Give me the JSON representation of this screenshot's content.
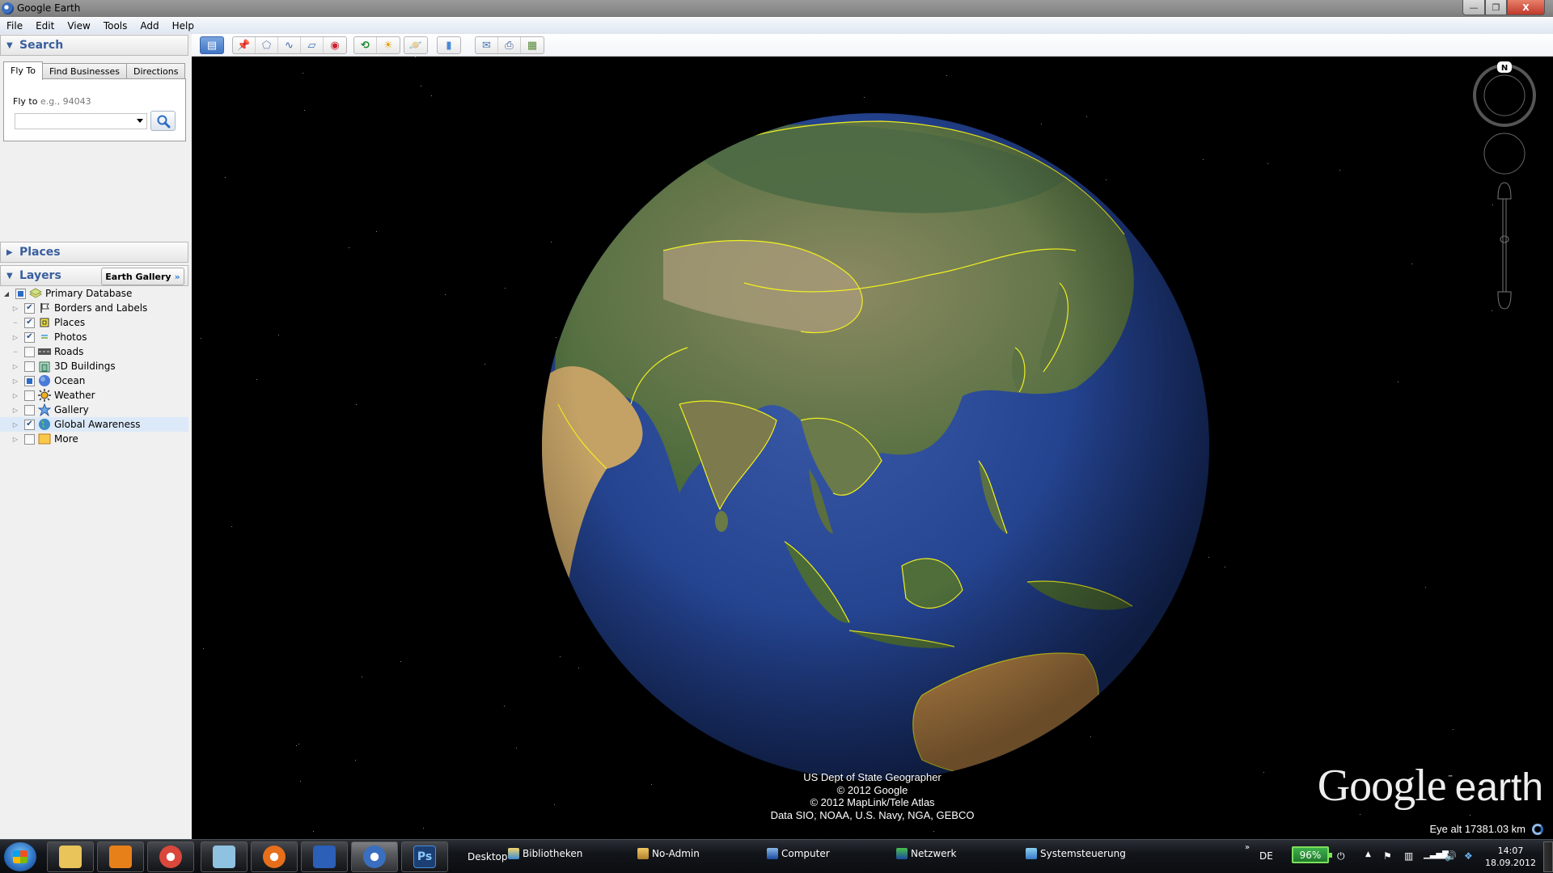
{
  "window": {
    "title": "Google Earth",
    "controls": {
      "minimize": "—",
      "maximize": "❐",
      "close": "X"
    }
  },
  "menu": [
    "File",
    "Edit",
    "View",
    "Tools",
    "Add",
    "Help"
  ],
  "search_panel": {
    "header": "Search",
    "tabs": [
      {
        "label": "Fly To",
        "active": true
      },
      {
        "label": "Find Businesses",
        "active": false
      },
      {
        "label": "Directions",
        "active": false
      }
    ],
    "flyto_label": "Fly to",
    "flyto_hint": "e.g., 94043",
    "flyto_value": ""
  },
  "places_panel": {
    "header": "Places"
  },
  "layers_panel": {
    "header": "Layers",
    "earth_gallery_button": "Earth Gallery",
    "earth_gallery_arrow": "»",
    "root": {
      "label": "Primary Database",
      "state": "partial"
    },
    "items": [
      {
        "label": "Borders and Labels",
        "checked": true,
        "icon": "flag-icon",
        "expandable": true
      },
      {
        "label": "Places",
        "checked": true,
        "icon": "places-icon",
        "expandable": false
      },
      {
        "label": "Photos",
        "checked": true,
        "icon": "photos-icon",
        "expandable": true
      },
      {
        "label": "Roads",
        "checked": false,
        "icon": "roads-icon",
        "expandable": false
      },
      {
        "label": "3D Buildings",
        "checked": false,
        "icon": "buildings-icon",
        "expandable": true
      },
      {
        "label": "Ocean",
        "checked": "partial",
        "icon": "ocean-icon",
        "expandable": true
      },
      {
        "label": "Weather",
        "checked": false,
        "icon": "weather-icon",
        "expandable": true
      },
      {
        "label": "Gallery",
        "checked": false,
        "icon": "gallery-star-icon",
        "expandable": true
      },
      {
        "label": "Global Awareness",
        "checked": true,
        "icon": "globe-icon",
        "expandable": true,
        "selected": true
      },
      {
        "label": "More",
        "checked": false,
        "icon": "more-folder-icon",
        "expandable": true
      }
    ]
  },
  "toolbar": {
    "buttons": [
      {
        "name": "sidebar-toggle",
        "glyph": "▤"
      },
      {
        "name": "add-placemark",
        "glyph": "📌"
      },
      {
        "name": "add-polygon",
        "glyph": "⬠"
      },
      {
        "name": "add-path",
        "glyph": "∿"
      },
      {
        "name": "add-image-overlay",
        "glyph": "▱"
      },
      {
        "name": "record-tour",
        "glyph": "◉"
      },
      {
        "name": "historical-imagery",
        "glyph": "⟲"
      },
      {
        "name": "sunlight",
        "glyph": "☀"
      },
      {
        "name": "switch-planet",
        "glyph": "🪐"
      },
      {
        "name": "ruler",
        "glyph": "▮"
      },
      {
        "name": "email",
        "glyph": "✉"
      },
      {
        "name": "print",
        "glyph": "⎙"
      },
      {
        "name": "view-in-maps",
        "glyph": "▦"
      }
    ]
  },
  "map": {
    "compass_north": "N",
    "attribution": [
      "US Dept of State Geographer",
      "© 2012 Google",
      "© 2012 MapLink/Tele Atlas",
      "Data SIO, NOAA, U.S. Navy, NGA, GEBCO"
    ],
    "logo_google": "Google",
    "logo_tm": "™",
    "logo_earth": "earth",
    "eye_alt": "Eye alt 17381.03 km"
  },
  "taskbar": {
    "pinned": [
      {
        "name": "explorer",
        "color": "#e8c45a"
      },
      {
        "name": "media-player",
        "color": "#e8801a"
      },
      {
        "name": "chrome",
        "color": "#d9483b"
      },
      {
        "name": "notepad",
        "color": "#8fc2e0"
      },
      {
        "name": "firefox",
        "color": "#e76f1c"
      },
      {
        "name": "word",
        "color": "#2b5fb8"
      },
      {
        "name": "google-earth",
        "color": "#3a6fc0",
        "active": true
      },
      {
        "name": "photoshop",
        "color": "#1c3f73"
      }
    ],
    "photoshop_label": "Ps",
    "desktop_label": "Desktop",
    "quick_links": [
      "Bibliotheken",
      "No-Admin",
      "Computer",
      "Netzwerk",
      "Systemsteuerung"
    ],
    "overflow": "»",
    "language": "DE",
    "battery": "96%",
    "time": "14:07",
    "date": "18.09.2012"
  }
}
